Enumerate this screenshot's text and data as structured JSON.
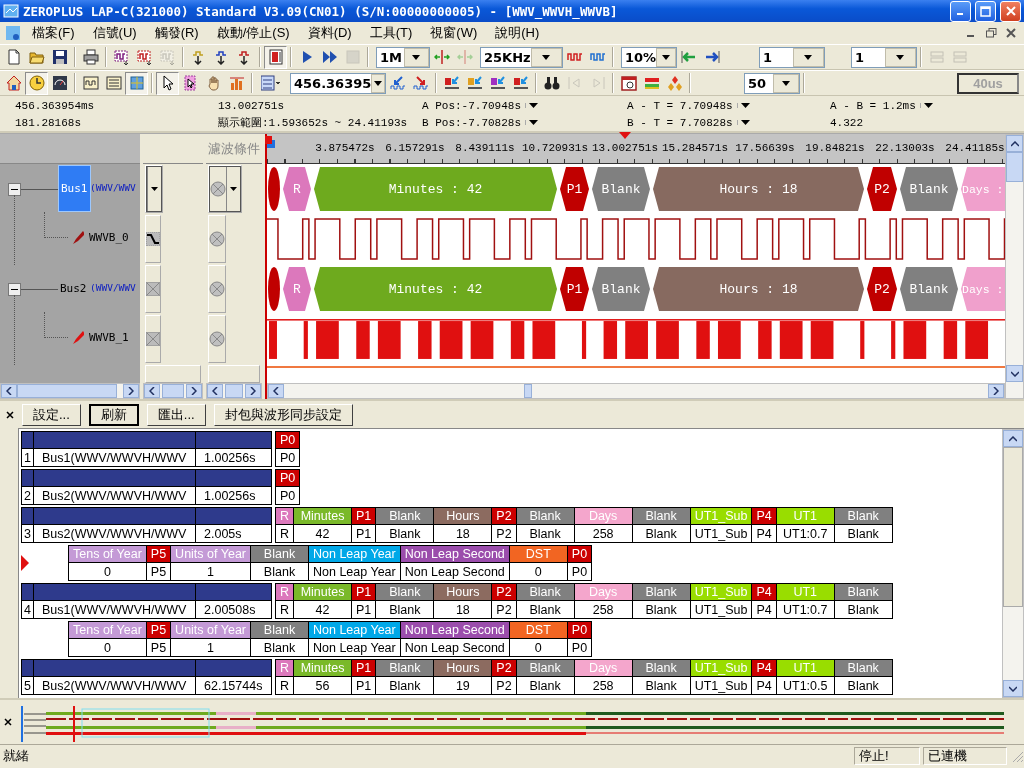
{
  "window": {
    "title": "ZEROPLUS LAP-C(321000) Standard V3.09(CN01) (S/N:00000000005) - [WWV_WWVH_WWVB]"
  },
  "menu": [
    "檔案(F)",
    "信號(U)",
    "觸發(R)",
    "啟動/停止(S)",
    "資料(D)",
    "工具(T)",
    "視窗(W)",
    "說明(H)"
  ],
  "toolbar_1": [
    {
      "kind": "button",
      "pressed": false,
      "disabled": false
    },
    {
      "kind": "button",
      "pressed": false,
      "disabled": false
    },
    {
      "kind": "button",
      "pressed": false,
      "disabled": false
    },
    {
      "kind": "separator"
    },
    {
      "kind": "button",
      "pressed": false,
      "disabled": false
    },
    {
      "kind": "separator"
    },
    {
      "kind": "button",
      "pressed": false,
      "disabled": false
    },
    {
      "kind": "button",
      "pressed": false,
      "disabled": false
    },
    {
      "kind": "button",
      "pressed": false,
      "disabled": true
    },
    {
      "kind": "separator"
    },
    {
      "kind": "button",
      "pressed": false,
      "disabled": false
    },
    {
      "kind": "button",
      "pressed": false,
      "disabled": false
    },
    {
      "kind": "button",
      "pressed": false,
      "disabled": false
    },
    {
      "kind": "separator"
    },
    {
      "kind": "button",
      "pressed": true,
      "disabled": false
    },
    {
      "kind": "separator"
    },
    {
      "kind": "button",
      "pressed": false,
      "disabled": false
    },
    {
      "kind": "button",
      "pressed": false,
      "disabled": false
    },
    {
      "kind": "button",
      "pressed": false,
      "disabled": true
    },
    {
      "kind": "separator"
    },
    {
      "kind": "combo",
      "value": "1M"
    },
    {
      "kind": "button",
      "pressed": false,
      "disabled": false
    },
    {
      "kind": "button",
      "pressed": false,
      "disabled": true
    },
    {
      "kind": "combo",
      "value": "25KHz"
    },
    {
      "kind": "button",
      "pressed": false,
      "disabled": false
    },
    {
      "kind": "button",
      "pressed": false,
      "disabled": false
    },
    {
      "kind": "separator"
    },
    {
      "kind": "combo",
      "value": "10%"
    },
    {
      "kind": "button",
      "pressed": false,
      "disabled": false
    },
    {
      "kind": "button",
      "pressed": false,
      "disabled": false
    },
    {
      "kind": "combo",
      "value": "1"
    },
    {
      "kind": "combo",
      "value": "1"
    },
    {
      "kind": "separator"
    },
    {
      "kind": "button",
      "pressed": false,
      "disabled": true
    },
    {
      "kind": "button",
      "pressed": false,
      "disabled": true
    }
  ],
  "toolbar_2": [
    {
      "kind": "button",
      "pressed": false,
      "disabled": false
    },
    {
      "kind": "button",
      "pressed": true,
      "disabled": false
    },
    {
      "kind": "button",
      "pressed": false,
      "disabled": false
    },
    {
      "kind": "separator"
    },
    {
      "kind": "button",
      "pressed": false,
      "disabled": false
    },
    {
      "kind": "button",
      "pressed": false,
      "disabled": false
    },
    {
      "kind": "button",
      "pressed": true,
      "disabled": false
    },
    {
      "kind": "separator"
    },
    {
      "kind": "button",
      "pressed": true,
      "disabled": false
    },
    {
      "kind": "button",
      "pressed": false,
      "disabled": false
    },
    {
      "kind": "button",
      "pressed": false,
      "disabled": false
    },
    {
      "kind": "button",
      "pressed": false,
      "disabled": false
    },
    {
      "kind": "separator"
    },
    {
      "kind": "button",
      "pressed": false,
      "disabled": false
    },
    {
      "kind": "combo",
      "value": "456.36395"
    },
    {
      "kind": "button",
      "pressed": false,
      "disabled": false
    },
    {
      "kind": "button",
      "pressed": false,
      "disabled": false
    },
    {
      "kind": "separator"
    },
    {
      "kind": "button",
      "pressed": false,
      "disabled": false
    },
    {
      "kind": "button",
      "pressed": false,
      "disabled": false
    },
    {
      "kind": "button",
      "pressed": false,
      "disabled": false
    },
    {
      "kind": "button",
      "pressed": false,
      "disabled": false
    },
    {
      "kind": "separator"
    },
    {
      "kind": "button",
      "pressed": false,
      "disabled": false
    },
    {
      "kind": "button",
      "pressed": false,
      "disabled": true
    },
    {
      "kind": "button",
      "pressed": false,
      "disabled": true
    },
    {
      "kind": "separator"
    },
    {
      "kind": "button",
      "pressed": false,
      "disabled": false
    },
    {
      "kind": "button",
      "pressed": false,
      "disabled": false
    },
    {
      "kind": "button",
      "pressed": false,
      "disabled": false
    },
    {
      "kind": "separator"
    },
    {
      "kind": "combo",
      "value": "50"
    },
    {
      "kind": "separator"
    },
    {
      "kind": "display",
      "value": "40us",
      "disabled": true
    }
  ],
  "info": [
    [
      {
        "text": "456.363954ms",
        "dropdown": false
      },
      {
        "text": "13.002751s",
        "dropdown": false
      },
      {
        "text": "A Pos:-7.70948s",
        "dropdown": true
      },
      {
        "text": "A - T = 7.70948s",
        "dropdown": true
      },
      {
        "text": "A - B = 1.2ms",
        "dropdown": true
      }
    ],
    [
      {
        "text": "181.28168s",
        "dropdown": false
      },
      {
        "text": "顯示範圍:1.593652s ~ 24.41193s",
        "dropdown": false
      },
      {
        "text": "B Pos:-7.70828s",
        "dropdown": true
      },
      {
        "text": "B - T = 7.70828s",
        "dropdown": true
      },
      {
        "text": "4.322",
        "dropdown": false
      }
    ]
  ],
  "filter_header": "濾波條件",
  "ruler": [
    {
      "label": "3.875472s",
      "trigger": false
    },
    {
      "label": "6.157291s",
      "trigger": false
    },
    {
      "label": "8.439111s",
      "trigger": false
    },
    {
      "label": "10.720931s",
      "trigger": false
    },
    {
      "label": "13.002751s",
      "trigger": true
    },
    {
      "label": "15.284571s",
      "trigger": false
    },
    {
      "label": "17.56639s",
      "trigger": false
    },
    {
      "label": "19.84821s",
      "trigger": false
    },
    {
      "label": "22.13003s",
      "trigger": false
    },
    {
      "label": "24.41185s",
      "trigger": false
    }
  ],
  "signals": [
    {
      "name": "Bus1",
      "detail": "(WWV/WWV",
      "selected": true,
      "expanded": true,
      "trigger": {
        "kind": "dropdown"
      },
      "filter": {
        "kind": "dropdown"
      },
      "segments": [
        {
          "kind": "blip",
          "color": "#c00000"
        },
        {
          "kind": "field",
          "label": "R",
          "color": "#dc78bc"
        },
        {
          "kind": "field",
          "label": "Minutes : 42",
          "color": "#6eaa1e"
        },
        {
          "kind": "field",
          "label": "P1",
          "color": "#c00000"
        },
        {
          "kind": "field",
          "label": "Blank",
          "color": "#808080"
        },
        {
          "kind": "field",
          "label": "Hours : 18",
          "color": "#876a60"
        },
        {
          "kind": "field",
          "label": "P2",
          "color": "#c00000"
        },
        {
          "kind": "field",
          "label": "Blank",
          "color": "#808080"
        },
        {
          "kind": "field",
          "label": "Days :",
          "color": "#f0a0cc"
        }
      ],
      "children": [
        {
          "name": "WWVB_0",
          "color": "#a01010",
          "kind": "trace",
          "trigger": {
            "kind": "falling-edge"
          },
          "filter": {
            "kind": "off"
          }
        }
      ]
    },
    {
      "name": "Bus2",
      "detail": "(WWV/WWV",
      "selected": false,
      "expanded": true,
      "trigger": {
        "kind": "dont-care"
      },
      "filter": {
        "kind": "off"
      },
      "segments": [
        {
          "kind": "blip",
          "color": "#c00000"
        },
        {
          "kind": "field",
          "label": "R",
          "color": "#dc78bc"
        },
        {
          "kind": "field",
          "label": "Minutes : 42",
          "color": "#6eaa1e"
        },
        {
          "kind": "field",
          "label": "P1",
          "color": "#c00000"
        },
        {
          "kind": "field",
          "label": "Blank",
          "color": "#808080"
        },
        {
          "kind": "field",
          "label": "Hours : 18",
          "color": "#876a60"
        },
        {
          "kind": "field",
          "label": "P2",
          "color": "#c00000"
        },
        {
          "kind": "field",
          "label": "Blank",
          "color": "#808080"
        },
        {
          "kind": "field",
          "label": "Days :",
          "color": "#f0a0cc"
        }
      ],
      "children": [
        {
          "name": "WWVB_1",
          "color": "#e01010",
          "kind": "bars",
          "trigger": {
            "kind": "dont-care"
          },
          "filter": {
            "kind": "off"
          }
        }
      ]
    }
  ],
  "packet_buttons": [
    {
      "label": "設定...",
      "default": false
    },
    {
      "label": "刷新",
      "default": true
    },
    {
      "label": "匯出...",
      "default": false
    },
    {
      "label": "封包與波形同步設定",
      "default": false
    }
  ],
  "packets": [
    {
      "index": "1",
      "name": "Bus1(WWV/WWVH/WWV",
      "time": "1.00256s",
      "lines": [
        {
          "current": false,
          "fields": [
            {
              "label": "P0",
              "color": "#cc0000",
              "value": "P0"
            }
          ]
        }
      ]
    },
    {
      "index": "2",
      "name": "Bus2(WWV/WWVH/WWV",
      "time": "1.00256s",
      "lines": [
        {
          "current": false,
          "fields": [
            {
              "label": "P0",
              "color": "#cc0000",
              "value": "P0"
            }
          ]
        }
      ]
    },
    {
      "index": "3",
      "name": "Bus2(WWV/WWVH/WWV",
      "time": "2.005s",
      "lines": [
        {
          "current": false,
          "fields": [
            {
              "label": "R",
              "color": "#dc78bc",
              "value": "R"
            },
            {
              "label": "Minutes",
              "color": "#7ab929",
              "value": "42"
            },
            {
              "label": "P1",
              "color": "#cc0000",
              "value": "P1"
            },
            {
              "label": "Blank",
              "color": "#808080",
              "value": "Blank"
            },
            {
              "label": "Hours",
              "color": "#8c6b60",
              "value": "18"
            },
            {
              "label": "P2",
              "color": "#cc0000",
              "value": "P2"
            },
            {
              "label": "Blank",
              "color": "#808080",
              "value": "Blank"
            },
            {
              "label": "Days",
              "color": "#f4a6cc",
              "value": "258"
            },
            {
              "label": "Blank",
              "color": "#808080",
              "value": "Blank"
            },
            {
              "label": "UT1_Sub",
              "color": "#99dd00",
              "value": "UT1_Sub"
            },
            {
              "label": "P4",
              "color": "#cc0000",
              "value": "P4"
            },
            {
              "label": "UT1",
              "color": "#99dd00",
              "value": "UT1:0.7"
            },
            {
              "label": "Blank",
              "color": "#808080",
              "value": "Blank"
            }
          ]
        },
        {
          "current": true,
          "fields": [
            {
              "label": "Tens of Year",
              "color": "#c49ad6",
              "value": "0"
            },
            {
              "label": "P5",
              "color": "#cc0000",
              "value": "P5"
            },
            {
              "label": "Units of Year",
              "color": "#c49ad6",
              "value": "1"
            },
            {
              "label": "Blank",
              "color": "#808080",
              "value": "Blank"
            },
            {
              "label": "Non Leap Year",
              "color": "#00a8e8",
              "value": "Non Leap Year"
            },
            {
              "label": "Non Leap Second",
              "color": "#9b4dac",
              "value": "Non Leap Second"
            },
            {
              "label": "DST",
              "color": "#f26522",
              "value": "0"
            },
            {
              "label": "P0",
              "color": "#cc0000",
              "value": "P0"
            }
          ]
        }
      ]
    },
    {
      "index": "4",
      "name": "Bus1(WWV/WWVH/WWV",
      "time": "2.00508s",
      "lines": [
        {
          "current": false,
          "fields": [
            {
              "label": "R",
              "color": "#dc78bc",
              "value": "R"
            },
            {
              "label": "Minutes",
              "color": "#7ab929",
              "value": "42"
            },
            {
              "label": "P1",
              "color": "#cc0000",
              "value": "P1"
            },
            {
              "label": "Blank",
              "color": "#808080",
              "value": "Blank"
            },
            {
              "label": "Hours",
              "color": "#8c6b60",
              "value": "18"
            },
            {
              "label": "P2",
              "color": "#cc0000",
              "value": "P2"
            },
            {
              "label": "Blank",
              "color": "#808080",
              "value": "Blank"
            },
            {
              "label": "Days",
              "color": "#f4a6cc",
              "value": "258"
            },
            {
              "label": "Blank",
              "color": "#808080",
              "value": "Blank"
            },
            {
              "label": "UT1_Sub",
              "color": "#99dd00",
              "value": "UT1_Sub"
            },
            {
              "label": "P4",
              "color": "#cc0000",
              "value": "P4"
            },
            {
              "label": "UT1",
              "color": "#99dd00",
              "value": "UT1:0.7"
            },
            {
              "label": "Blank",
              "color": "#808080",
              "value": "Blank"
            }
          ]
        },
        {
          "current": false,
          "fields": [
            {
              "label": "Tens of Year",
              "color": "#c49ad6",
              "value": "0"
            },
            {
              "label": "P5",
              "color": "#cc0000",
              "value": "P5"
            },
            {
              "label": "Units of Year",
              "color": "#c49ad6",
              "value": "1"
            },
            {
              "label": "Blank",
              "color": "#808080",
              "value": "Blank"
            },
            {
              "label": "Non Leap Year",
              "color": "#00a8e8",
              "value": "Non Leap Year"
            },
            {
              "label": "Non Leap Second",
              "color": "#9b4dac",
              "value": "Non Leap Second"
            },
            {
              "label": "DST",
              "color": "#f26522",
              "value": "0"
            },
            {
              "label": "P0",
              "color": "#cc0000",
              "value": "P0"
            }
          ]
        }
      ]
    },
    {
      "index": "5",
      "name": "Bus2(WWV/WWVH/WWV",
      "time": "62.15744s",
      "lines": [
        {
          "current": false,
          "fields": [
            {
              "label": "R",
              "color": "#dc78bc",
              "value": "R"
            },
            {
              "label": "Minutes",
              "color": "#7ab929",
              "value": "56"
            },
            {
              "label": "P1",
              "color": "#cc0000",
              "value": "P1"
            },
            {
              "label": "Blank",
              "color": "#808080",
              "value": "Blank"
            },
            {
              "label": "Hours",
              "color": "#8c6b60",
              "value": "19"
            },
            {
              "label": "P2",
              "color": "#cc0000",
              "value": "P2"
            },
            {
              "label": "Blank",
              "color": "#808080",
              "value": "Blank"
            },
            {
              "label": "Days",
              "color": "#f4a6cc",
              "value": "258"
            },
            {
              "label": "Blank",
              "color": "#808080",
              "value": "Blank"
            },
            {
              "label": "UT1_Sub",
              "color": "#99dd00",
              "value": "UT1_Sub"
            },
            {
              "label": "P4",
              "color": "#cc0000",
              "value": "P4"
            },
            {
              "label": "UT1",
              "color": "#99dd00",
              "value": "UT1:0.5"
            },
            {
              "label": "Blank",
              "color": "#808080",
              "value": "Blank"
            }
          ]
        }
      ]
    }
  ],
  "status_bar": {
    "message": "就緒",
    "panels": [
      "停止!",
      "已連機"
    ]
  }
}
